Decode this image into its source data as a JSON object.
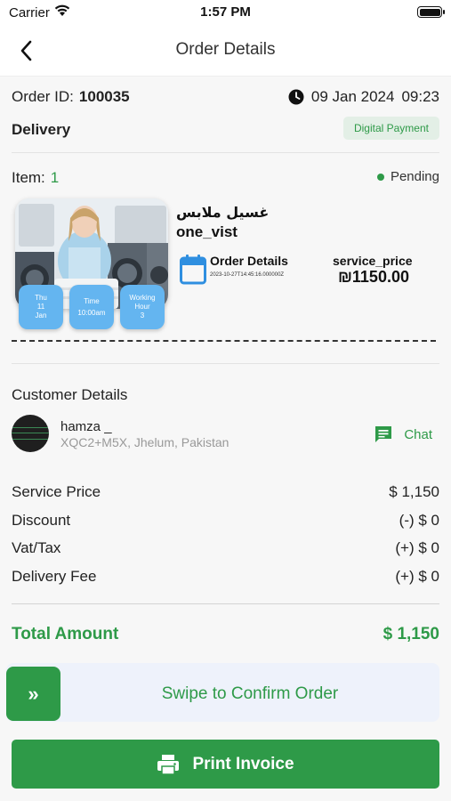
{
  "status_bar": {
    "carrier": "Carrier",
    "time": "1:57 PM"
  },
  "nav": {
    "title": "Order Details"
  },
  "order": {
    "id_label": "Order ID:",
    "id_value": "100035",
    "date": "09 Jan 2024",
    "time": "09:23",
    "type": "Delivery",
    "payment_badge": "Digital Payment"
  },
  "item": {
    "label": "Item:",
    "count": "1",
    "status": "Pending",
    "name_arabic": "غسيل ملابس",
    "name": "one_vist",
    "details_label": "Order Details",
    "details_timestamp": "2023-10-27T14:45:16.000000Z",
    "price_label": "service_price",
    "price_value": "₪1150.00",
    "chips": {
      "day": [
        "Thu",
        "11",
        "Jan"
      ],
      "time": [
        "Time",
        "10:00am"
      ],
      "hours": [
        "Working",
        "Hour",
        "3"
      ]
    }
  },
  "customer": {
    "title": "Customer Details",
    "name": "hamza _",
    "address": "XQC2+M5X, Jhelum, Pakistan",
    "chat_label": "Chat"
  },
  "pricing": [
    {
      "label": "Service Price",
      "value": "$ 1,150"
    },
    {
      "label": "Discount",
      "value": "(-) $ 0"
    },
    {
      "label": "Vat/Tax",
      "value": "(+) $ 0"
    },
    {
      "label": "Delivery Fee",
      "value": "(+) $ 0"
    }
  ],
  "total": {
    "label": "Total Amount",
    "value": "$ 1,150"
  },
  "actions": {
    "swipe_icon": "»",
    "swipe_label": "Swipe to Confirm Order",
    "print_label": "Print Invoice"
  },
  "colors": {
    "accent": "#2e9a48",
    "chip": "#64b5f0",
    "badge_bg": "#e3efe6"
  },
  "icons": [
    "wifi-icon",
    "battery-icon",
    "back-chevron-icon",
    "clock-icon",
    "calendar-icon",
    "chat-icon",
    "printer-icon",
    "double-chevron-icon"
  ]
}
